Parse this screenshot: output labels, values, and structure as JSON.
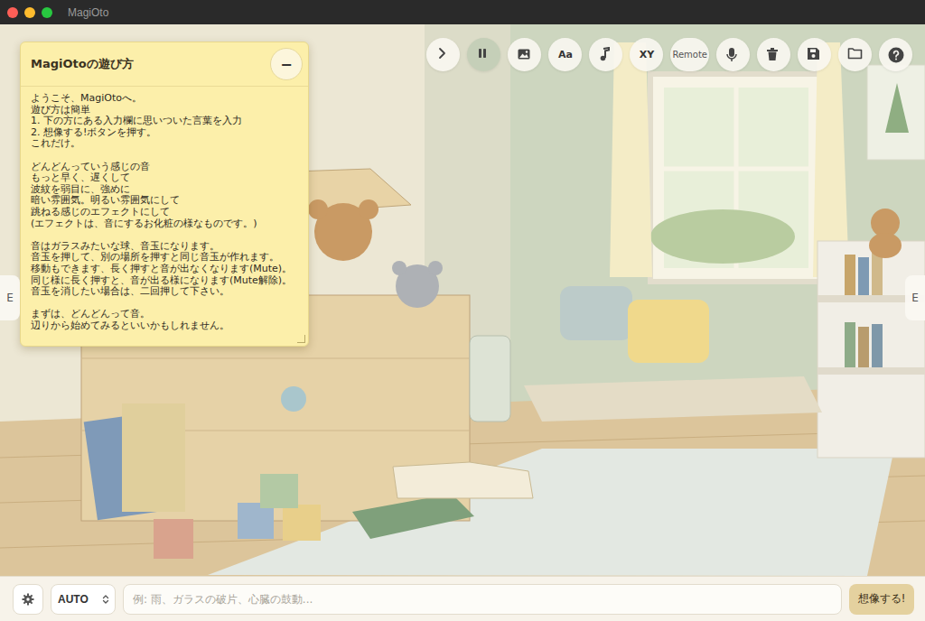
{
  "window": {
    "title": "MagiOto"
  },
  "toolbar": [
    {
      "kind": "icon",
      "selected": false
    },
    {
      "kind": "icon",
      "selected": true
    },
    {
      "kind": "icon",
      "selected": false
    },
    {
      "kind": "text",
      "label": "Aa",
      "selected": false
    },
    {
      "kind": "icon",
      "selected": false
    },
    {
      "kind": "text",
      "label": "XY",
      "selected": false
    },
    {
      "kind": "text",
      "label": "Remote",
      "selected": false
    },
    {
      "kind": "icon",
      "selected": false
    },
    {
      "kind": "icon",
      "selected": false
    },
    {
      "kind": "icon",
      "selected": false
    },
    {
      "kind": "icon",
      "selected": false
    },
    {
      "kind": "icon",
      "selected": false
    }
  ],
  "guide": {
    "title": "MagiOtoの遊び方",
    "minimize": "−",
    "paragraphs": [
      [
        "ようこそ、MagiOtoへ。",
        "遊び方は簡単",
        "1. 下の方にある入力欄に思いついた言葉を入力",
        "2. 想像する!ボタンを押す。",
        "これだけ。"
      ],
      [
        "どんどんっていう感じの音",
        "もっと早く、遅くして",
        "波紋を弱目に、強めに",
        "暗い雰囲気。明るい雰囲気にして",
        "跳ねる感じのエフェクトにして",
        "(エフェクトは、音にするお化粧の様なものです。)"
      ],
      [
        "音はガラスみたいな球、音玉になります。",
        "音玉を押して、別の場所を押すと同じ音玉が作れます。",
        "移動もできます、長く押すと音が出なくなります(Mute)。",
        "同じ様に長く押すと、音が出る様になります(Mute解除)。",
        "音玉を消したい場合は、二回押して下さい。"
      ],
      [
        "まずは、どんどんって音。",
        "辺りから始めてみるといいかもしれません。"
      ]
    ]
  },
  "side_tabs": {
    "left": "E",
    "right": "E"
  },
  "bottom": {
    "mode": "AUTO",
    "placeholder": "例: 雨、ガラスの破片、心臓の鼓動...",
    "submit": "想像する!"
  }
}
